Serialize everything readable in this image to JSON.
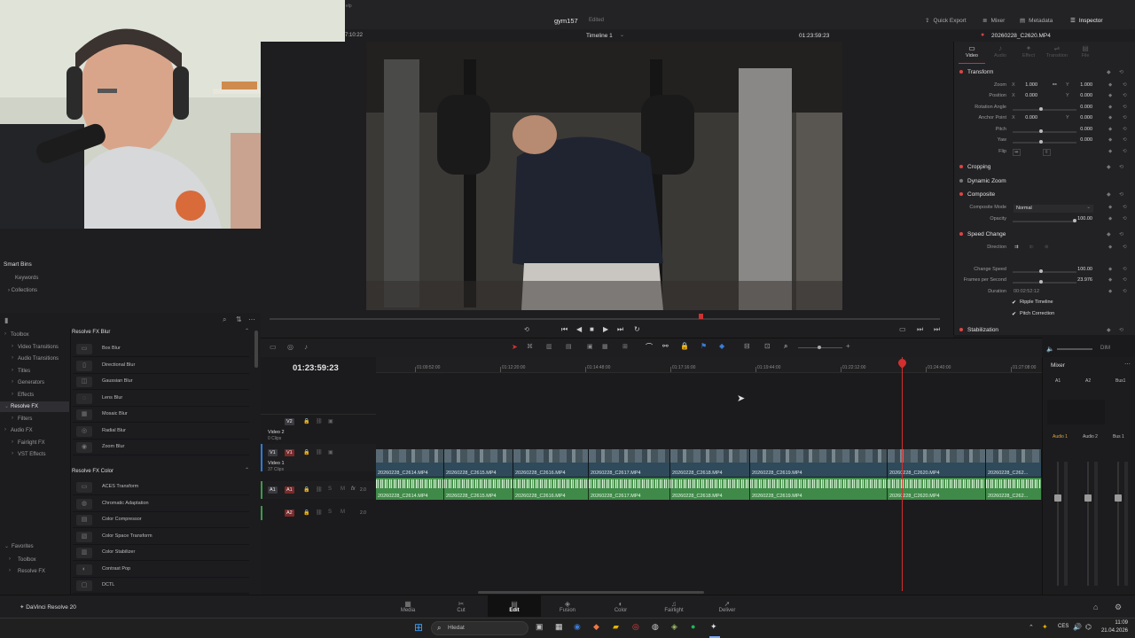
{
  "app": {
    "project_name": "gym157",
    "project_status": "Edited",
    "timeline_name": "Timeline 1",
    "timecode_viewer": "01:23:59:23",
    "clip_name": "20260228_C2620.MP4",
    "left_timecode": "7:10:22",
    "logo": "DaVinci Resolve 20"
  },
  "top_tabs": [
    {
      "label": "Quick Export",
      "icon": "export-icon"
    },
    {
      "label": "Mixer",
      "icon": "mixer-icon"
    },
    {
      "label": "Metadata",
      "icon": "metadata-icon"
    },
    {
      "label": "Inspector",
      "icon": "inspector-icon"
    }
  ],
  "inspector": {
    "tabs": [
      "Video",
      "Audio",
      "Effect",
      "Transition",
      "File"
    ],
    "transform": {
      "title": "Transform",
      "zoom_label": "Zoom",
      "zoom_x": "1.000",
      "zoom_y": "1.000",
      "position_label": "Position",
      "position_x": "0.000",
      "position_y": "0.000",
      "rotation_label": "Rotation Angle",
      "rotation": "0.000",
      "anchor_label": "Anchor Point",
      "anchor_x": "0.000",
      "anchor_y": "0.000",
      "pitch_label": "Pitch",
      "pitch": "0.000",
      "yaw_label": "Yaw",
      "yaw": "0.000",
      "flip_label": "Flip",
      "x_label": "X",
      "y_label": "Y"
    },
    "cropping": "Cropping",
    "dynamic_zoom": "Dynamic Zoom",
    "composite": {
      "title": "Composite",
      "mode_label": "Composite Mode",
      "mode": "Normal",
      "opacity_label": "Opacity",
      "opacity": "100.00"
    },
    "speed_change": {
      "title": "Speed Change",
      "direction_label": "Direction",
      "change_speed_label": "Change Speed",
      "change_speed": "100.00",
      "fps_label": "Frames per Second",
      "fps": "23.976",
      "duration_label": "Duration",
      "duration": "00:02:52:12",
      "ripple_label": "Ripple Timeline",
      "pitch_corr_label": "Pitch Correction"
    },
    "stabilization": "Stabilization"
  },
  "media_pool": {
    "smart_bins": "Smart Bins",
    "keywords": "Keywords",
    "collections": "Collections"
  },
  "effects": {
    "tree": [
      {
        "label": "Toolbox",
        "indent": 0
      },
      {
        "label": "Video Transitions",
        "indent": 1
      },
      {
        "label": "Audio Transitions",
        "indent": 1
      },
      {
        "label": "Titles",
        "indent": 1
      },
      {
        "label": "Generators",
        "indent": 1
      },
      {
        "label": "Effects",
        "indent": 1
      },
      {
        "label": "Resolve FX",
        "indent": 0,
        "selected": true
      },
      {
        "label": "Filters",
        "indent": 1
      },
      {
        "label": "Audio FX",
        "indent": 0
      },
      {
        "label": "Fairlight FX",
        "indent": 1
      },
      {
        "label": "VST Effects",
        "indent": 1
      }
    ],
    "favorites": "Favorites",
    "fav_items": [
      "Toolbox",
      "Resolve FX"
    ],
    "group1": "Resolve FX Blur",
    "group1_items": [
      "Box Blur",
      "Directional Blur",
      "Gaussian Blur",
      "Lens Blur",
      "Mosaic Blur",
      "Radial Blur",
      "Zoom Blur"
    ],
    "group2": "Resolve FX Color",
    "group2_items": [
      "ACES Transform",
      "Chromatic Adaptation",
      "Color Compressor",
      "Color Space Transform",
      "Color Stabilizer",
      "Contrast Pop",
      "DCTL"
    ]
  },
  "timeline": {
    "timecode": "01:23:59:23",
    "ruler": [
      "01:09:52:00",
      "01:12:20:00",
      "01:14:48:00",
      "01:17:16:00",
      "01:19:44:00",
      "01:22:12:00",
      "01:24:40:00",
      "01:27:08:00"
    ],
    "tracks": {
      "v2": "V2",
      "v2_name": "Video 2",
      "v2_count": "0 Clips",
      "v1": "V1",
      "v1_name": "Video 1",
      "v1_count": "37 Clips",
      "a1": "A1",
      "a1_level": "2.0",
      "a2": "A2",
      "a2_level": "2.0",
      "fx": "fx"
    },
    "video_clips": [
      "20260228_C2614.MP4",
      "20260228_C2615.MP4",
      "20260228_C2616.MP4",
      "20260228_C2617.MP4",
      "20260228_C2618.MP4",
      "20260228_C2619.MP4",
      "20260228_C2620.MP4",
      "20260228_C262..."
    ],
    "audio_clips": [
      "20260228_C2614.MP4",
      "20260228_C2615.MP4",
      "20260228_C2616.MP4",
      "20260228_C2617.MP4",
      "20260228_C2618.MP4",
      "20260228_C2619.MP4",
      "20260228_C2620.MP4",
      "20260228_C262..."
    ]
  },
  "mixer": {
    "title": "Mixer",
    "ch": [
      "A1",
      "A2",
      "Bus1"
    ],
    "strips": [
      "Audio 1",
      "Audio 2",
      "Bus 1"
    ],
    "dim": "DIM"
  },
  "pages": [
    {
      "label": "Media",
      "glyph": "▦"
    },
    {
      "label": "Cut",
      "glyph": "✂"
    },
    {
      "label": "Edit",
      "glyph": "▤",
      "active": true
    },
    {
      "label": "Fusion",
      "glyph": "◈"
    },
    {
      "label": "Color",
      "glyph": "◐"
    },
    {
      "label": "Fairlight",
      "glyph": "♫"
    },
    {
      "label": "Deliver",
      "glyph": "➚"
    }
  ],
  "taskbar": {
    "search_placeholder": "Hledat",
    "lang": "CES",
    "time": "11:09",
    "date": "21.04.2026"
  }
}
